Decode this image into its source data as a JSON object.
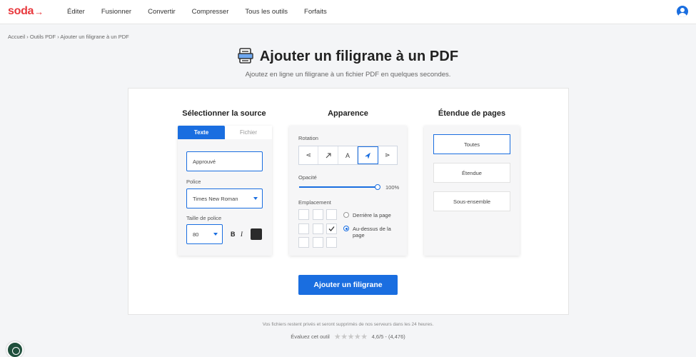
{
  "header": {
    "logo_text": "soda",
    "logo_arrow": "→",
    "nav": [
      "Éditer",
      "Fusionner",
      "Convertir",
      "Compresser",
      "Tous les outils",
      "Forfaits"
    ],
    "user_icon": "user-icon"
  },
  "breadcrumb": [
    "Accueil",
    "Outils PDF",
    "Ajouter un filigrane à un PDF"
  ],
  "page": {
    "title": "Ajouter un filigrane à un PDF",
    "subtitle": "Ajoutez en ligne un filigrane à un fichier PDF en quelques secondes."
  },
  "source": {
    "title": "Sélectionner la source",
    "tabs": [
      "Texte",
      "Fichier"
    ],
    "active_tab": "Texte",
    "text_value": "Approuvé",
    "font_label": "Police",
    "font_value": "Times New Roman",
    "size_label": "Taille de police",
    "size_value": "80",
    "bold": "B",
    "italic": "I",
    "text_color": "#2b2b2b"
  },
  "appearance": {
    "title": "Apparence",
    "rotation_label": "Rotation",
    "rotation_options": [
      "⋖",
      "⊿",
      "A",
      "⊿",
      "⋗"
    ],
    "rotation_active_index": 3,
    "opacity_label": "Opacité",
    "opacity_value": "100%",
    "placement_label": "Emplacement",
    "placement_checked_cell": 5,
    "layer_options": [
      "Derrière la page",
      "Au-dessus de la page"
    ],
    "layer_selected": "Au-dessus de la page"
  },
  "pages": {
    "title": "Étendue de pages",
    "options": [
      "Toutes",
      "Étendue",
      "Sous-ensemble"
    ],
    "selected": "Toutes"
  },
  "submit_label": "Ajouter un filigrane",
  "footnote": "Vos fichiers restent privés et seront supprimés de nos serveurs dans les 24 heures.",
  "rating": {
    "label": "Évaluez cet outil",
    "stars": "★★★★★",
    "score": "4,6/5 - (4,476)"
  },
  "colors": {
    "accent": "#1a6ee0",
    "brand": "#e8383d"
  }
}
